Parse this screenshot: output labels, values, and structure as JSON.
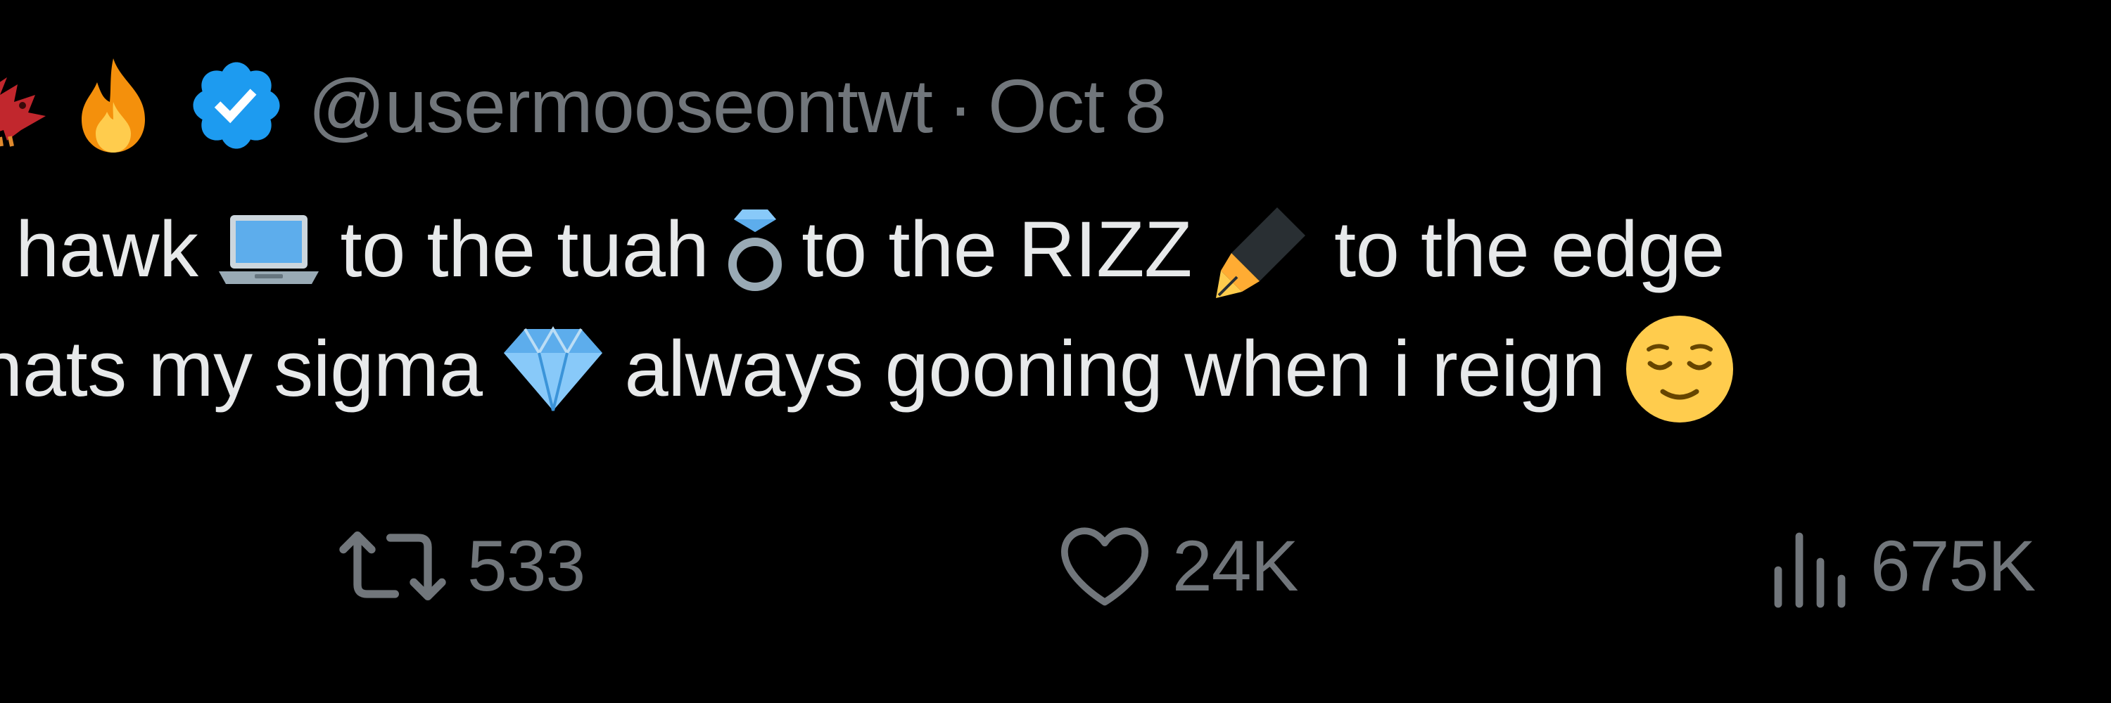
{
  "header": {
    "emojis": [
      "bird-emoji",
      "fire-emoji"
    ],
    "verified": true,
    "handle": "@usermooseontwt",
    "separator": "·",
    "timestamp": "Oct 8"
  },
  "tweet": {
    "line1": [
      {
        "type": "text",
        "value": "hawk"
      },
      {
        "type": "emoji",
        "icon": "laptop-emoji"
      },
      {
        "type": "text",
        "value": "to the tuah"
      },
      {
        "type": "emoji",
        "icon": "ring-emoji"
      },
      {
        "type": "text",
        "value": "to the RIZZ"
      },
      {
        "type": "emoji",
        "icon": "fountain-pen-emoji"
      },
      {
        "type": "text",
        "value": "to the edge"
      }
    ],
    "line2": [
      {
        "type": "text",
        "value": "hats my sigma"
      },
      {
        "type": "emoji",
        "icon": "gem-stone-emoji"
      },
      {
        "type": "text",
        "value": "always gooning when i reign"
      },
      {
        "type": "emoji",
        "icon": "relieved-face-emoji"
      }
    ],
    "segments": {
      "s1": "hawk",
      "s2": "to the tuah",
      "s3": "to the RIZZ",
      "s4": "to the edge",
      "s5": "hats my sigma",
      "s6": "always gooning when i reign"
    }
  },
  "actions": {
    "retweet": {
      "icon": "retweet-icon",
      "count": "533"
    },
    "like": {
      "icon": "heart-icon",
      "count": "24K"
    },
    "views": {
      "icon": "views-chart-icon",
      "count": "675K"
    }
  },
  "colors": {
    "background": "#000000",
    "text": "#e7e9ea",
    "muted": "#71767b",
    "verified": "#1d9bf0"
  }
}
